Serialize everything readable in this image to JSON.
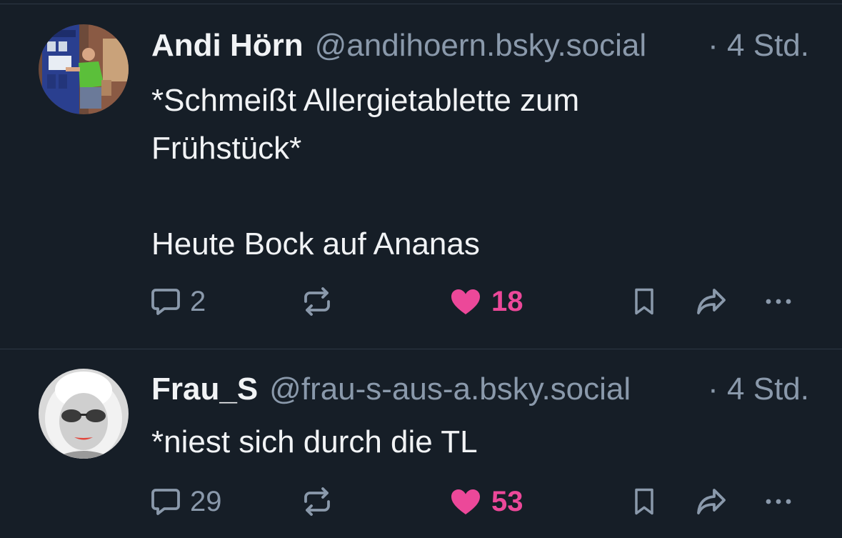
{
  "posts": [
    {
      "author_name": "Andi Hörn",
      "handle": "@andihoern.bsky.social",
      "time": "· 4 Std.",
      "text_lines": [
        "*Schmeißt Allergietablette zum",
        "Frühstück*",
        "Heute Bock auf Ananas"
      ],
      "replies": "2",
      "reposts": "",
      "likes": "18",
      "liked": true,
      "avatar_icon": "avatar-photo-man-green-shirt"
    },
    {
      "author_name": "Frau_S",
      "handle": "@frau-s-aus-a.bsky.social",
      "time": "· 4 Std.",
      "text_lines": [
        "*niest sich durch die TL"
      ],
      "replies": "29",
      "reposts": "",
      "likes": "53",
      "liked": true,
      "avatar_icon": "avatar-photo-woman-sunglasses"
    }
  ],
  "icons": {
    "reply": "speech-bubble-icon",
    "repost": "repost-arrows-icon",
    "like": "heart-icon",
    "save": "bookmark-icon",
    "share": "share-arrow-icon",
    "more": "ellipsis-icon"
  },
  "colors": {
    "background": "#161e27",
    "text_primary": "#f1f3f5",
    "text_secondary": "#8a99ab",
    "like_active": "#ec4899",
    "divider": "#2e3845"
  }
}
